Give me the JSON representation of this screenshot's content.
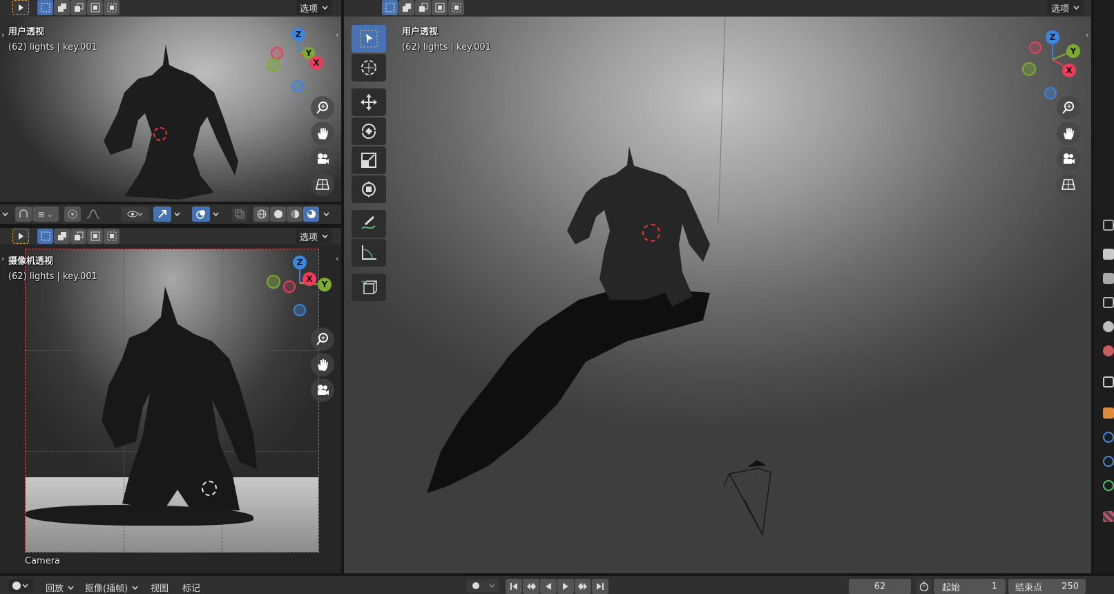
{
  "top_left_view": {
    "options_label": "选项",
    "view_name": "用户透视",
    "frame_info": "(62) lights | key.001"
  },
  "bottom_left_view": {
    "options_label": "选项",
    "view_name": "摄像机透视",
    "frame_info": "(62) lights | key.001",
    "camera_label": "Camera"
  },
  "main_view": {
    "options_label": "选项",
    "view_name": "用户透视",
    "frame_info": "(62) lights | key.001"
  },
  "gizmo": {
    "z": "Z",
    "y": "Y",
    "x": "X"
  },
  "timeline": {
    "menu_playback": "回放",
    "menu_keying": "抠像(插帧)",
    "menu_view": "视图",
    "menu_marker": "标记",
    "current_frame": "62",
    "start_label": "起始",
    "start_value": "1",
    "end_label": "结束点",
    "end_value": "250"
  },
  "colors": {
    "axis_x": "#ee3d5c",
    "axis_y": "#7cab2e",
    "axis_z": "#3b87e0",
    "accent": "#4772b3"
  }
}
